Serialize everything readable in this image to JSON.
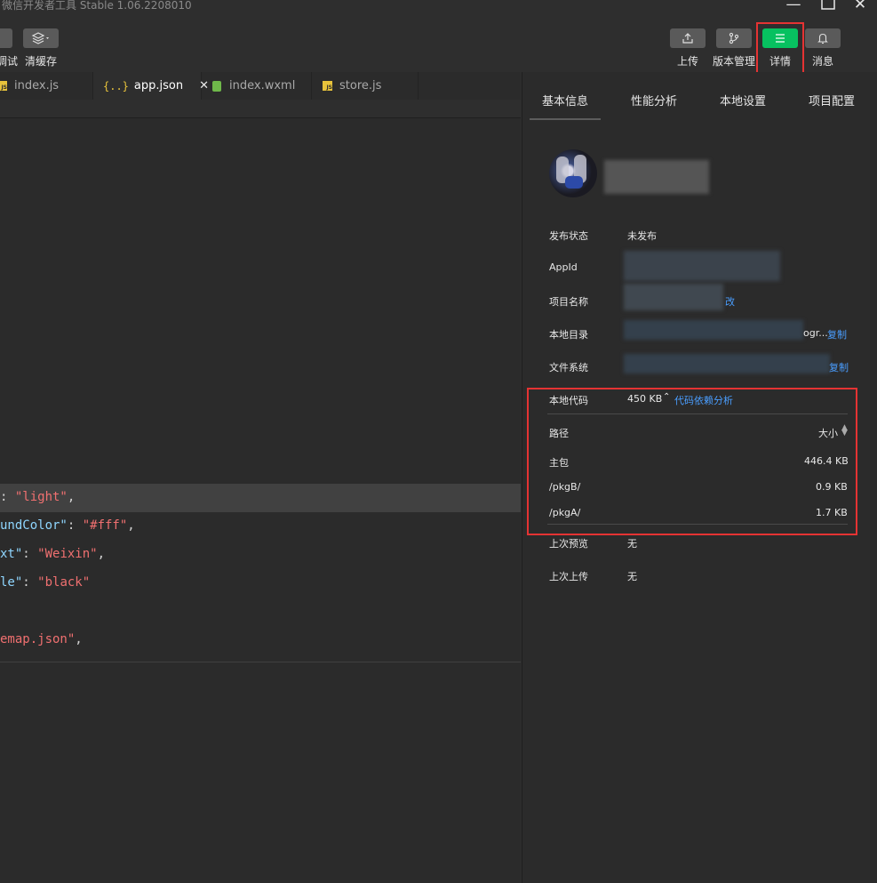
{
  "window": {
    "title": "微信开发者工具 Stable 1.06.2208010",
    "controls": [
      "minimize-icon",
      "maximize-icon",
      "close-icon"
    ]
  },
  "toolbar": {
    "left": [
      {
        "label": "调试",
        "icon": "bug-icon"
      },
      {
        "label": "清缓存",
        "icon": "layers-icon"
      }
    ],
    "right": [
      {
        "label": "上传",
        "icon": "upload-icon"
      },
      {
        "label": "版本管理",
        "icon": "git-branch-icon"
      },
      {
        "label": "详情",
        "icon": "menu-icon",
        "highlighted": true
      },
      {
        "label": "消息",
        "icon": "bell-icon"
      }
    ],
    "accent": "#07c160"
  },
  "tabs": [
    {
      "label": "index.js",
      "icon": "js-file-icon"
    },
    {
      "label": "app.json",
      "icon": "json-file-icon",
      "active": true
    },
    {
      "label": "index.wxml",
      "icon": "wxml-file-icon"
    },
    {
      "label": "store.js",
      "icon": "js-file-icon"
    }
  ],
  "code": {
    "lines": [
      {
        "key": "",
        "sep": ": ",
        "value": "\"light\"",
        "tail": ","
      },
      {
        "key": "undColor\"",
        "sep": ": ",
        "value": "\"#fff\"",
        "tail": ","
      },
      {
        "key": "xt\"",
        "sep": ": ",
        "value": "\"Weixin\"",
        "tail": ","
      },
      {
        "key": "le\"",
        "sep": ": ",
        "value": "\"black\"",
        "tail": ""
      },
      {
        "key": "",
        "sep": "",
        "value": "emap.json\"",
        "tail": ","
      }
    ]
  },
  "details": {
    "tabs": [
      "基本信息",
      "性能分析",
      "本地设置",
      "项目配置"
    ],
    "active_tab": "基本信息",
    "rows": {
      "publish_status": {
        "label": "发布状态",
        "value": "未发布"
      },
      "appid": {
        "label": "AppId"
      },
      "project_name": {
        "label": "项目名称",
        "link": "修改",
        "link_visible": "改"
      },
      "local_dir": {
        "label": "本地目录",
        "value_tail": "ogr...",
        "link": "复制"
      },
      "file_system": {
        "label": "文件系统",
        "link": "复制",
        "link_visible": "复制"
      },
      "local_code": {
        "label": "本地代码",
        "value": "450 KB",
        "link": "代码依赖分析"
      },
      "last_preview": {
        "label": "上次预览",
        "value": "无"
      },
      "last_upload": {
        "label": "上次上传",
        "value": "无"
      }
    },
    "package_table": {
      "headers": {
        "path": "路径",
        "size": "大小"
      },
      "rows": [
        {
          "path": "主包",
          "size": "446.4 KB"
        },
        {
          "path": "/pkgB/",
          "size": "0.9 KB"
        },
        {
          "path": "/pkgA/",
          "size": "1.7 KB"
        }
      ]
    }
  }
}
